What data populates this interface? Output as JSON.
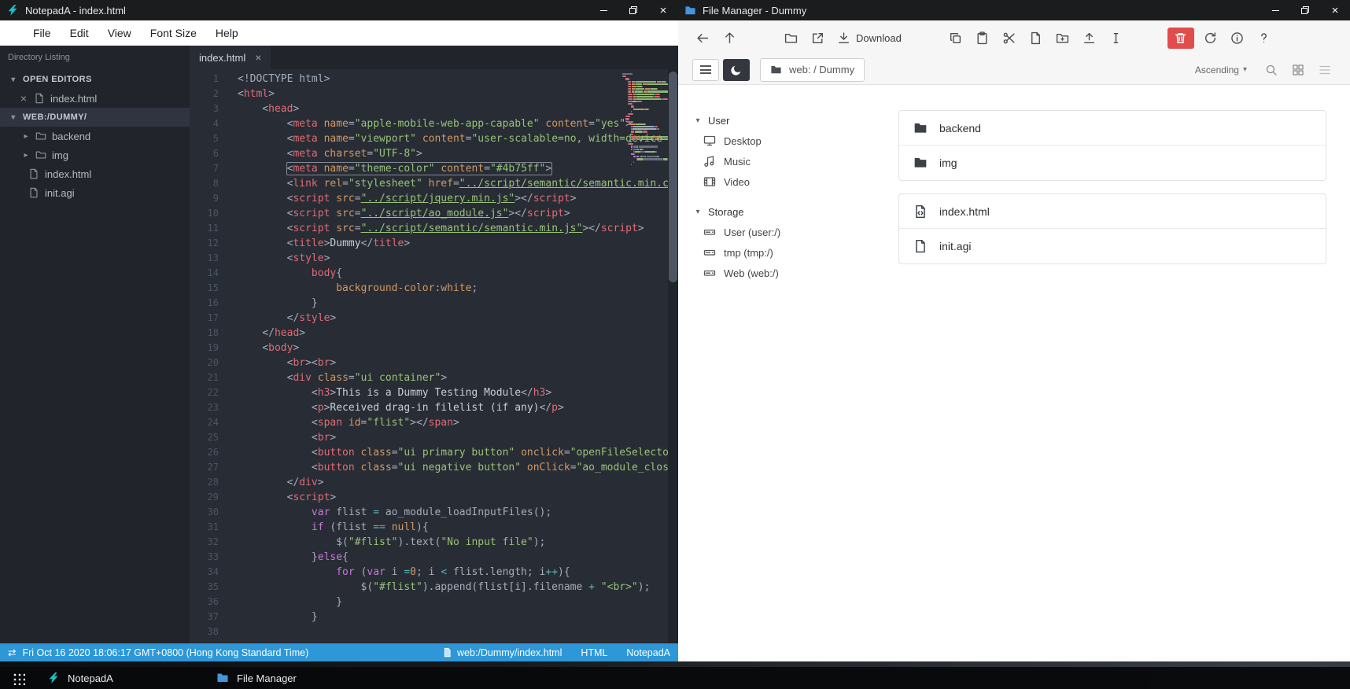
{
  "notepad": {
    "title": "NotepadA - index.html",
    "menu": [
      "File",
      "Edit",
      "View",
      "Font Size",
      "Help"
    ],
    "sidebar": {
      "header": "Directory Listing",
      "sections": [
        {
          "label": "OPEN EDITORS",
          "type": "open-editors",
          "selected": false,
          "items": [
            {
              "name": "index.html",
              "icon": "file"
            }
          ]
        },
        {
          "label": "WEB:/DUMMY/",
          "type": "workspace",
          "selected": true,
          "items": [
            {
              "name": "backend",
              "icon": "folder"
            },
            {
              "name": "img",
              "icon": "folder"
            },
            {
              "name": "index.html",
              "icon": "file"
            },
            {
              "name": "init.agi",
              "icon": "file"
            }
          ]
        }
      ]
    },
    "tab": {
      "label": "index.html",
      "close_glyph": "×"
    },
    "editor": {
      "lines": [
        [
          [
            "p",
            "<!DOCTYPE html>"
          ]
        ],
        [
          [
            "p",
            "<"
          ],
          [
            "t",
            "html"
          ],
          [
            "p",
            ">"
          ]
        ],
        [
          [
            "p",
            "    <"
          ],
          [
            "t",
            "head"
          ],
          [
            "p",
            ">"
          ]
        ],
        [
          [
            "p",
            "        <"
          ],
          [
            "t",
            "meta"
          ],
          [
            "p",
            " "
          ],
          [
            "a",
            "name"
          ],
          [
            "p",
            "="
          ],
          [
            "s",
            "\"apple-mobile-web-app-capable\""
          ],
          [
            "p",
            " "
          ],
          [
            "a",
            "content"
          ],
          [
            "p",
            "="
          ],
          [
            "s",
            "\"yes\""
          ],
          [
            "p",
            ">"
          ]
        ],
        [
          [
            "p",
            "        <"
          ],
          [
            "t",
            "meta"
          ],
          [
            "p",
            " "
          ],
          [
            "a",
            "name"
          ],
          [
            "p",
            "="
          ],
          [
            "s",
            "\"viewport\""
          ],
          [
            "p",
            " "
          ],
          [
            "a",
            "content"
          ],
          [
            "p",
            "="
          ],
          [
            "s",
            "\"user-scalable=no, width=device-width\""
          ],
          [
            "p",
            "/>"
          ]
        ],
        [
          [
            "p",
            "        <"
          ],
          [
            "t",
            "meta"
          ],
          [
            "p",
            " "
          ],
          [
            "a",
            "charset"
          ],
          [
            "p",
            "="
          ],
          [
            "s",
            "\"UTF-8\""
          ],
          [
            "p",
            ">"
          ]
        ],
        {
          "mark": true,
          "seg": [
            [
              "p",
              "        "
            ],
            [
              "p",
              "<"
            ],
            [
              "t",
              "meta"
            ],
            [
              "p",
              " "
            ],
            [
              "a",
              "name"
            ],
            [
              "p",
              "="
            ],
            [
              "s",
              "\"theme-color\""
            ],
            [
              "p",
              " "
            ],
            [
              "a",
              "content"
            ],
            [
              "p",
              "="
            ],
            [
              "s",
              "\"#4b75ff\""
            ],
            [
              "p",
              ">"
            ]
          ]
        },
        [
          [
            "p",
            "        <"
          ],
          [
            "t",
            "link"
          ],
          [
            "p",
            " "
          ],
          [
            "a",
            "rel"
          ],
          [
            "p",
            "="
          ],
          [
            "s",
            "\"stylesheet\""
          ],
          [
            "p",
            " "
          ],
          [
            "a",
            "href"
          ],
          [
            "p",
            "="
          ],
          [
            "u",
            "\"../script/semantic/semantic.min.css\""
          ],
          [
            "p",
            ">"
          ]
        ],
        [
          [
            "p",
            "        <"
          ],
          [
            "t",
            "script"
          ],
          [
            "p",
            " "
          ],
          [
            "a",
            "src"
          ],
          [
            "p",
            "="
          ],
          [
            "u",
            "\"../script/jquery.min.js\""
          ],
          [
            "p",
            "></"
          ],
          [
            "t",
            "script"
          ],
          [
            "p",
            ">"
          ]
        ],
        [
          [
            "p",
            "        <"
          ],
          [
            "t",
            "script"
          ],
          [
            "p",
            " "
          ],
          [
            "a",
            "src"
          ],
          [
            "p",
            "="
          ],
          [
            "u",
            "\"../script/ao_module.js\""
          ],
          [
            "p",
            "></"
          ],
          [
            "t",
            "script"
          ],
          [
            "p",
            ">"
          ]
        ],
        [
          [
            "p",
            "        <"
          ],
          [
            "t",
            "script"
          ],
          [
            "p",
            " "
          ],
          [
            "a",
            "src"
          ],
          [
            "p",
            "="
          ],
          [
            "u",
            "\"../script/semantic/semantic.min.js\""
          ],
          [
            "p",
            "></"
          ],
          [
            "t",
            "script"
          ],
          [
            "p",
            ">"
          ]
        ],
        [
          [
            "p",
            "        <"
          ],
          [
            "t",
            "title"
          ],
          [
            "p",
            ">"
          ],
          [
            "x",
            "Dummy"
          ],
          [
            "p",
            "</"
          ],
          [
            "t",
            "title"
          ],
          [
            "p",
            ">"
          ]
        ],
        [
          [
            "p",
            "        <"
          ],
          [
            "t",
            "style"
          ],
          [
            "p",
            ">"
          ]
        ],
        [
          [
            "p",
            "            "
          ],
          [
            "t",
            "body"
          ],
          [
            "p",
            "{"
          ]
        ],
        [
          [
            "p",
            "                "
          ],
          [
            "a",
            "background-color"
          ],
          [
            "p",
            ":"
          ],
          [
            "n",
            "white"
          ],
          [
            "p",
            ";"
          ]
        ],
        [
          [
            "p",
            "            }"
          ]
        ],
        [
          [
            "p",
            "        </"
          ],
          [
            "t",
            "style"
          ],
          [
            "p",
            ">"
          ]
        ],
        [
          [
            "p",
            "    </"
          ],
          [
            "t",
            "head"
          ],
          [
            "p",
            ">"
          ]
        ],
        [
          [
            "p",
            "    <"
          ],
          [
            "t",
            "body"
          ],
          [
            "p",
            ">"
          ]
        ],
        [
          [
            "p",
            "        <"
          ],
          [
            "t",
            "br"
          ],
          [
            "p",
            "><"
          ],
          [
            "t",
            "br"
          ],
          [
            "p",
            ">"
          ]
        ],
        [
          [
            "p",
            "        <"
          ],
          [
            "t",
            "div"
          ],
          [
            "p",
            " "
          ],
          [
            "a",
            "class"
          ],
          [
            "p",
            "="
          ],
          [
            "s",
            "\"ui container\""
          ],
          [
            "p",
            ">"
          ]
        ],
        [
          [
            "p",
            "            <"
          ],
          [
            "t",
            "h3"
          ],
          [
            "p",
            ">"
          ],
          [
            "x",
            "This is a Dummy Testing Module"
          ],
          [
            "p",
            "</"
          ],
          [
            "t",
            "h3"
          ],
          [
            "p",
            ">"
          ]
        ],
        [
          [
            "p",
            "            <"
          ],
          [
            "t",
            "p"
          ],
          [
            "p",
            ">"
          ],
          [
            "x",
            "Received drag-in filelist (if any)"
          ],
          [
            "p",
            "</"
          ],
          [
            "t",
            "p"
          ],
          [
            "p",
            ">"
          ]
        ],
        [
          [
            "p",
            "            <"
          ],
          [
            "t",
            "span"
          ],
          [
            "p",
            " "
          ],
          [
            "a",
            "id"
          ],
          [
            "p",
            "="
          ],
          [
            "s",
            "\"flist\""
          ],
          [
            "p",
            "></"
          ],
          [
            "t",
            "span"
          ],
          [
            "p",
            ">"
          ]
        ],
        [
          [
            "p",
            "            <"
          ],
          [
            "t",
            "br"
          ],
          [
            "p",
            ">"
          ]
        ],
        [
          [
            "p",
            "            <"
          ],
          [
            "t",
            "button"
          ],
          [
            "p",
            " "
          ],
          [
            "a",
            "class"
          ],
          [
            "p",
            "="
          ],
          [
            "s",
            "\"ui primary button\""
          ],
          [
            "p",
            " "
          ],
          [
            "a",
            "onclick"
          ],
          [
            "p",
            "="
          ],
          [
            "s",
            "\"openFileSelector()\""
          ],
          [
            "p",
            ">"
          ]
        ],
        [
          [
            "p",
            "            <"
          ],
          [
            "t",
            "button"
          ],
          [
            "p",
            " "
          ],
          [
            "a",
            "class"
          ],
          [
            "p",
            "="
          ],
          [
            "s",
            "\"ui negative button\""
          ],
          [
            "p",
            " "
          ],
          [
            "a",
            "onClick"
          ],
          [
            "p",
            "="
          ],
          [
            "s",
            "\"ao_module_close();\""
          ],
          [
            "p",
            ">"
          ]
        ],
        [
          [
            "p",
            "        </"
          ],
          [
            "t",
            "div"
          ],
          [
            "p",
            ">"
          ]
        ],
        [
          [
            "p",
            "        <"
          ],
          [
            "t",
            "script"
          ],
          [
            "p",
            ">"
          ]
        ],
        [
          [
            "p",
            "            "
          ],
          [
            "k",
            "var"
          ],
          [
            "p",
            " flist "
          ],
          [
            "o",
            "="
          ],
          [
            "p",
            " ao_module_loadInputFiles();"
          ]
        ],
        [
          [
            "p",
            "            "
          ],
          [
            "k",
            "if"
          ],
          [
            "p",
            " (flist "
          ],
          [
            "o",
            "=="
          ],
          [
            "p",
            " "
          ],
          [
            "n",
            "null"
          ],
          [
            "p",
            "){"
          ]
        ],
        [
          [
            "p",
            "                $("
          ],
          [
            "s",
            "\"#flist\""
          ],
          [
            "p",
            ").text("
          ],
          [
            "s",
            "\"No input file\""
          ],
          [
            "p",
            ");"
          ]
        ],
        [
          [
            "p",
            "            }"
          ],
          [
            "k",
            "else"
          ],
          [
            "p",
            "{"
          ]
        ],
        [
          [
            "p",
            "                "
          ],
          [
            "k",
            "for"
          ],
          [
            "p",
            " ("
          ],
          [
            "k",
            "var"
          ],
          [
            "p",
            " i "
          ],
          [
            "o",
            "="
          ],
          [
            "n",
            "0"
          ],
          [
            "p",
            "; i "
          ],
          [
            "o",
            "<"
          ],
          [
            "p",
            " flist.length; i"
          ],
          [
            "o",
            "++"
          ],
          [
            "p",
            "){"
          ]
        ],
        [
          [
            "p",
            "                    $("
          ],
          [
            "s",
            "\"#flist\""
          ],
          [
            "p",
            ").append(flist[i].filename "
          ],
          [
            "o",
            "+"
          ],
          [
            "p",
            " "
          ],
          [
            "s",
            "\"<br>\""
          ],
          [
            "p",
            ");"
          ]
        ],
        [
          [
            "p",
            "                }"
          ]
        ],
        [
          [
            "p",
            "            }"
          ]
        ],
        [
          [
            "p",
            " "
          ]
        ]
      ]
    },
    "statusbar": {
      "datetime": "Fri Oct 16 2020 18:06:17 GMT+0800 (Hong Kong Standard Time)",
      "filepath": "web:/Dummy/index.html",
      "language": "HTML",
      "app": "NotepadA",
      "sync_glyph": "⇄"
    }
  },
  "filemanager": {
    "title": "File Manager - Dummy",
    "toolbar": {
      "buttons": [
        {
          "icon": "arrow-left",
          "name": "back"
        },
        {
          "icon": "arrow-up",
          "name": "up"
        },
        {
          "icon": "folder-open",
          "name": "open",
          "gap": "lg"
        },
        {
          "icon": "external-link",
          "name": "open-in-new-window"
        },
        {
          "icon": "download",
          "name": "download",
          "label": "Download"
        },
        {
          "icon": "copy",
          "name": "copy",
          "gap": "lg"
        },
        {
          "icon": "paste",
          "name": "paste"
        },
        {
          "icon": "scissors",
          "name": "cut"
        },
        {
          "icon": "file-new",
          "name": "new-file"
        },
        {
          "icon": "folder-new",
          "name": "new-folder"
        },
        {
          "icon": "upload",
          "name": "upload"
        },
        {
          "icon": "rename",
          "name": "rename"
        },
        {
          "icon": "trash",
          "name": "delete",
          "danger": true,
          "gap": "lg"
        },
        {
          "icon": "refresh",
          "name": "refresh"
        },
        {
          "icon": "info",
          "name": "info"
        },
        {
          "icon": "help",
          "name": "help"
        }
      ]
    },
    "pathbar": {
      "path": "web: / Dummy",
      "sort_order": "Ascending",
      "caret_glyph": "▾",
      "view_controls": [
        {
          "icon": "search",
          "name": "search"
        },
        {
          "icon": "grid",
          "name": "grid-view"
        },
        {
          "icon": "list",
          "name": "list-view",
          "muted": true
        }
      ]
    },
    "sidebar": [
      {
        "label": "User",
        "items": [
          {
            "label": "Desktop",
            "icon": "desktop"
          },
          {
            "label": "Music",
            "icon": "music"
          },
          {
            "label": "Video",
            "icon": "video"
          }
        ]
      },
      {
        "label": "Storage",
        "items": [
          {
            "label": "User (user:/)",
            "icon": "drive"
          },
          {
            "label": "tmp (tmp:/)",
            "icon": "drive"
          },
          {
            "label": "Web (web:/)",
            "icon": "drive"
          }
        ]
      }
    ],
    "file_groups": [
      {
        "items": [
          {
            "name": "backend",
            "icon": "folder"
          },
          {
            "name": "img",
            "icon": "folder"
          }
        ]
      },
      {
        "items": [
          {
            "name": "index.html",
            "icon": "file-code"
          },
          {
            "name": "init.agi",
            "icon": "file"
          }
        ]
      }
    ]
  },
  "taskbar": {
    "items": [
      {
        "label": "NotepadA",
        "icon": "notepad-logo"
      },
      {
        "label": "File Manager",
        "icon": "folder-blue"
      }
    ]
  }
}
